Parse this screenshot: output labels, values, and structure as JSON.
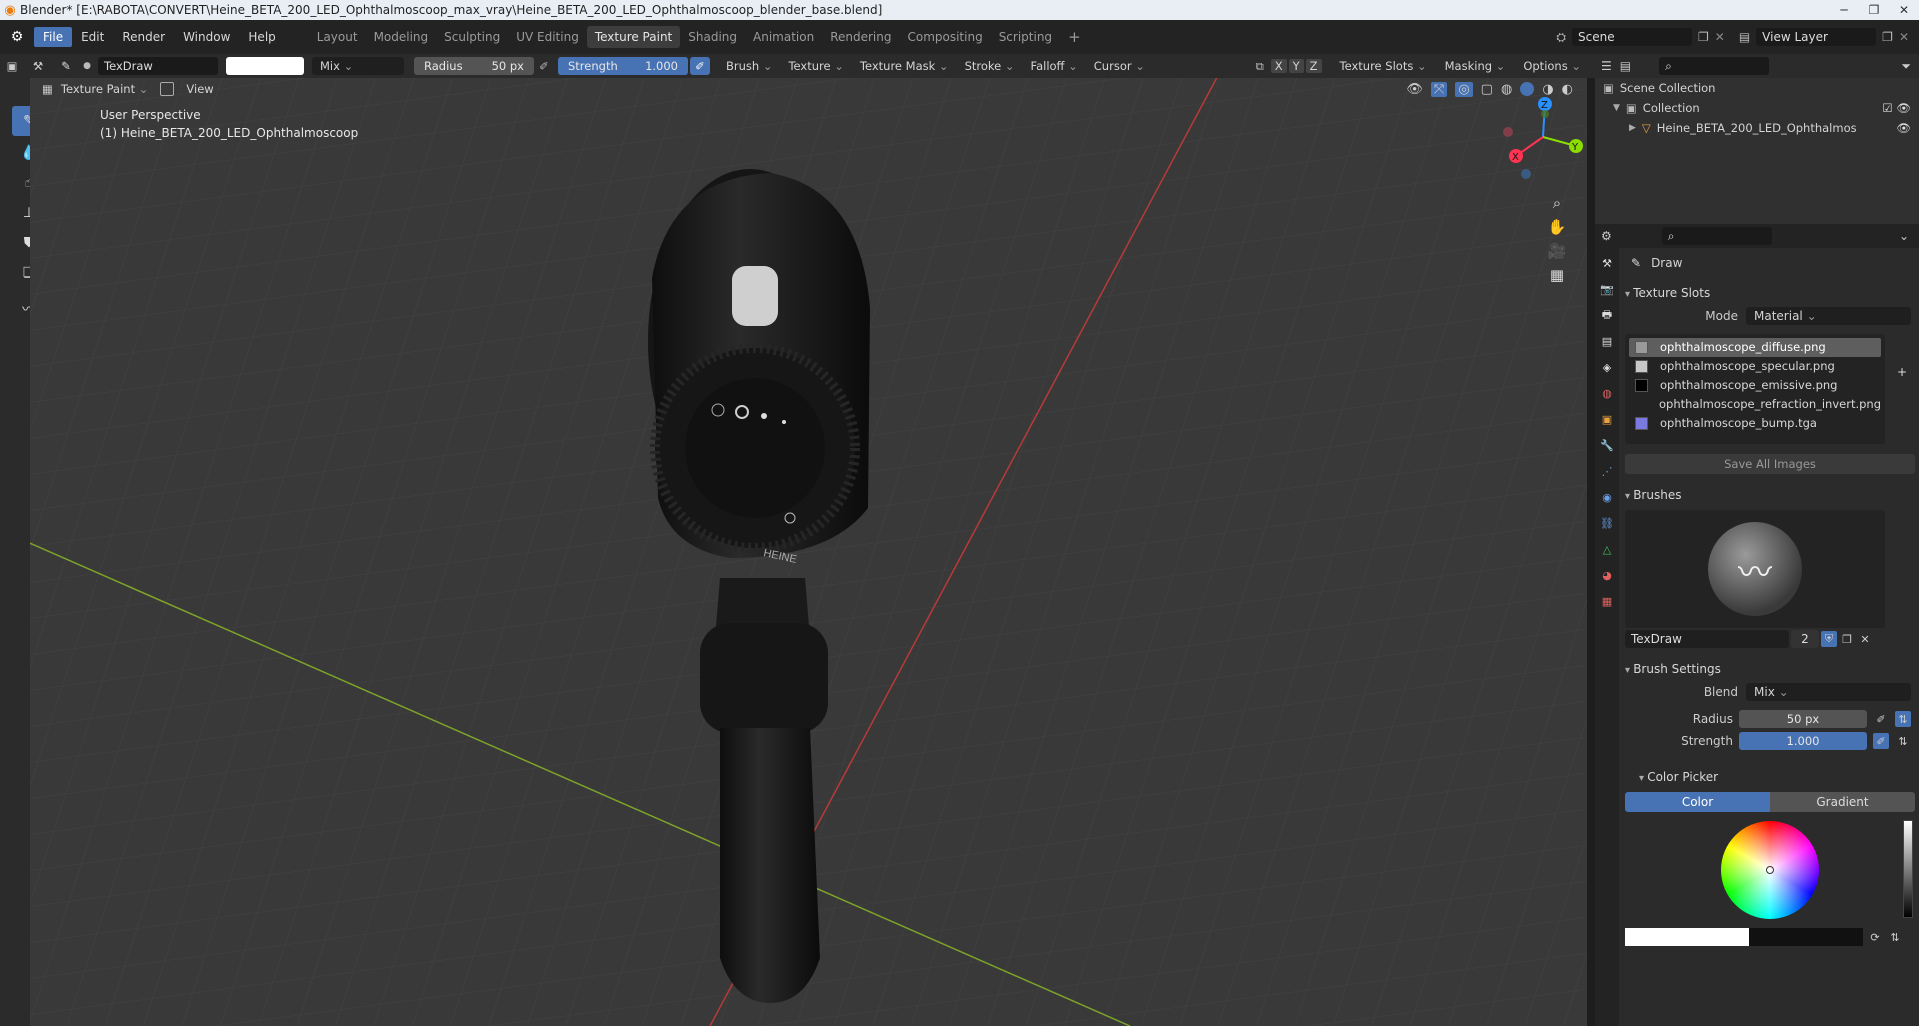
{
  "window": {
    "title": "Blender* [E:\\RABOTA\\CONVERT\\Heine_BETA_200_LED_Ophthalmoscoop_max_vray\\Heine_BETA_200_LED_Ophthalmoscoop_blender_base.blend]"
  },
  "menu": [
    "File",
    "Edit",
    "Render",
    "Window",
    "Help"
  ],
  "workspaces": [
    "Layout",
    "Modeling",
    "Sculpting",
    "UV Editing",
    "Texture Paint",
    "Shading",
    "Animation",
    "Rendering",
    "Compositing",
    "Scripting"
  ],
  "active_workspace": "Texture Paint",
  "scene": {
    "name": "Scene",
    "view_layer": "View Layer"
  },
  "tool_header": {
    "brush_name": "TexDraw",
    "blend": "Mix",
    "radius_label": "Radius",
    "radius_value": "50 px",
    "strength_label": "Strength",
    "strength_value": "1.000",
    "strength_fraction": 1.0,
    "brush_menu": "Brush",
    "texture_menu": "Texture",
    "texture_mask_menu": "Texture Mask",
    "stroke_menu": "Stroke",
    "falloff_menu": "Falloff",
    "cursor_menu": "Cursor",
    "axes": [
      "X",
      "Y",
      "Z"
    ],
    "texture_slots_menu": "Texture Slots",
    "masking_menu": "Masking",
    "options_menu": "Options"
  },
  "viewport": {
    "mode": "Texture Paint",
    "view_menu": "View",
    "perspective": "User Perspective",
    "object_label": "(1) Heine_BETA_200_LED_Ophthalmoscoop",
    "axes": [
      "Z",
      "Y",
      "X"
    ]
  },
  "outliner": {
    "scene_collection": "Scene Collection",
    "collection": "Collection",
    "object": "Heine_BETA_200_LED_Ophthalmoscoop"
  },
  "properties": {
    "tool_name": "Draw",
    "texture_slots": {
      "title": "Texture Slots",
      "mode_label": "Mode",
      "mode_value": "Material",
      "slots": [
        {
          "name": "ophthalmoscope_diffuse.png",
          "swatch": "#9a9a9a",
          "selected": true
        },
        {
          "name": "ophthalmoscope_specular.png",
          "swatch": "#c8c8c8",
          "selected": false
        },
        {
          "name": "ophthalmoscope_emissive.png",
          "swatch": "#000000",
          "selected": false
        },
        {
          "name": "ophthalmoscope_refraction_invert.png",
          "swatch": "",
          "selected": false
        },
        {
          "name": "ophthalmoscope_bump.tga",
          "swatch": "#7a7ae0",
          "selected": false
        }
      ],
      "save_all": "Save All Images"
    },
    "brushes": {
      "title": "Brushes",
      "name": "TexDraw",
      "users": "2"
    },
    "brush_settings": {
      "title": "Brush Settings",
      "blend_label": "Blend",
      "blend_value": "Mix",
      "radius_label": "Radius",
      "radius_value": "50 px",
      "strength_label": "Strength",
      "strength_value": "1.000"
    },
    "color_picker": {
      "title": "Color Picker",
      "tabs": [
        "Color",
        "Gradient"
      ],
      "active_tab": "Color",
      "current_color": "#ffffff"
    }
  },
  "colors": {
    "accent": "#4772b3",
    "axis_x": "#ff3352",
    "axis_y": "#8bdc00",
    "axis_z": "#2890ff"
  }
}
